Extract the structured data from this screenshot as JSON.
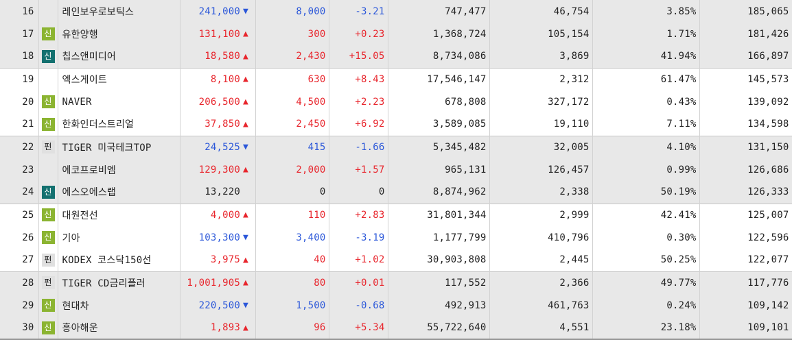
{
  "colors": {
    "up": "#e8262d",
    "down": "#2b57d9",
    "badge_new_green": "#8bb431",
    "badge_new_teal": "#13706f",
    "badge_fund": "#e0e0e0"
  },
  "rows": [
    {
      "rank": "16",
      "badge": "",
      "badge_style": "",
      "name": "레인보우로보틱스",
      "price": "241,000",
      "dir": "down",
      "change": "8,000",
      "rate": "-3.21",
      "volume": "747,477",
      "amount": "46,754",
      "ratio": "3.85%",
      "cap": "185,065"
    },
    {
      "rank": "17",
      "badge": "신",
      "badge_style": "shin-g",
      "name": "유한양행",
      "price": "131,100",
      "dir": "up",
      "change": "300",
      "rate": "+0.23",
      "volume": "1,368,724",
      "amount": "105,154",
      "ratio": "1.71%",
      "cap": "181,426"
    },
    {
      "rank": "18",
      "badge": "신",
      "badge_style": "shin-t",
      "name": "칩스앤미디어",
      "price": "18,580",
      "dir": "up",
      "change": "2,430",
      "rate": "+15.05",
      "volume": "8,734,086",
      "amount": "3,869",
      "ratio": "41.94%",
      "cap": "166,897"
    },
    {
      "rank": "19",
      "badge": "",
      "badge_style": "",
      "name": "엑스게이트",
      "price": "8,100",
      "dir": "up",
      "change": "630",
      "rate": "+8.43",
      "volume": "17,546,147",
      "amount": "2,312",
      "ratio": "61.47%",
      "cap": "145,573"
    },
    {
      "rank": "20",
      "badge": "신",
      "badge_style": "shin-g",
      "name": "NAVER",
      "price": "206,500",
      "dir": "up",
      "change": "4,500",
      "rate": "+2.23",
      "volume": "678,808",
      "amount": "327,172",
      "ratio": "0.43%",
      "cap": "139,092"
    },
    {
      "rank": "21",
      "badge": "신",
      "badge_style": "shin-g",
      "name": "한화인더스트리얼",
      "price": "37,850",
      "dir": "up",
      "change": "2,450",
      "rate": "+6.92",
      "volume": "3,589,085",
      "amount": "19,110",
      "ratio": "7.11%",
      "cap": "134,598"
    },
    {
      "rank": "22",
      "badge": "펀",
      "badge_style": "fund",
      "name": "TIGER 미국테크TOP",
      "price": "24,525",
      "dir": "down",
      "change": "415",
      "rate": "-1.66",
      "volume": "5,345,482",
      "amount": "32,005",
      "ratio": "4.10%",
      "cap": "131,150"
    },
    {
      "rank": "23",
      "badge": "",
      "badge_style": "",
      "name": "에코프로비엠",
      "price": "129,300",
      "dir": "up",
      "change": "2,000",
      "rate": "+1.57",
      "volume": "965,131",
      "amount": "126,457",
      "ratio": "0.99%",
      "cap": "126,686"
    },
    {
      "rank": "24",
      "badge": "신",
      "badge_style": "shin-t",
      "name": "에스오에스랩",
      "price": "13,220",
      "dir": "flat",
      "change": "0",
      "rate": "0",
      "volume": "8,874,962",
      "amount": "2,338",
      "ratio": "50.19%",
      "cap": "126,333"
    },
    {
      "rank": "25",
      "badge": "신",
      "badge_style": "shin-g",
      "name": "대원전선",
      "price": "4,000",
      "dir": "up",
      "change": "110",
      "rate": "+2.83",
      "volume": "31,801,344",
      "amount": "2,999",
      "ratio": "42.41%",
      "cap": "125,007"
    },
    {
      "rank": "26",
      "badge": "신",
      "badge_style": "shin-g",
      "name": "기아",
      "price": "103,300",
      "dir": "down",
      "change": "3,400",
      "rate": "-3.19",
      "volume": "1,177,799",
      "amount": "410,796",
      "ratio": "0.30%",
      "cap": "122,596"
    },
    {
      "rank": "27",
      "badge": "펀",
      "badge_style": "fund",
      "name": "KODEX 코스닥150선",
      "price": "3,975",
      "dir": "up",
      "change": "40",
      "rate": "+1.02",
      "volume": "30,903,808",
      "amount": "2,445",
      "ratio": "50.25%",
      "cap": "122,077"
    },
    {
      "rank": "28",
      "badge": "펀",
      "badge_style": "fund",
      "name": "TIGER CD금리플러",
      "price": "1,001,905",
      "dir": "up",
      "change": "80",
      "rate": "+0.01",
      "volume": "117,552",
      "amount": "2,366",
      "ratio": "49.77%",
      "cap": "117,776"
    },
    {
      "rank": "29",
      "badge": "신",
      "badge_style": "shin-g",
      "name": "현대차",
      "price": "220,500",
      "dir": "down",
      "change": "1,500",
      "rate": "-0.68",
      "volume": "492,913",
      "amount": "461,763",
      "ratio": "0.24%",
      "cap": "109,142"
    },
    {
      "rank": "30",
      "badge": "신",
      "badge_style": "shin-g",
      "name": "흥아해운",
      "price": "1,893",
      "dir": "up",
      "change": "96",
      "rate": "+5.34",
      "volume": "55,722,640",
      "amount": "4,551",
      "ratio": "23.18%",
      "cap": "109,101"
    }
  ]
}
